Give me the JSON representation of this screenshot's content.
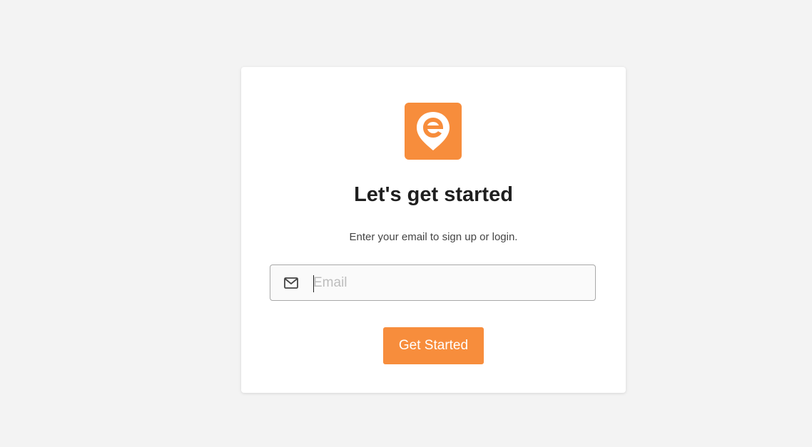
{
  "theme": {
    "page_background": "#f3f3f3",
    "card_background": "#ffffff",
    "accent": "#f78d3c"
  },
  "logo": {
    "icon": "location-pin-e-logo"
  },
  "heading": {
    "title": "Let's get started",
    "subtitle": "Enter your email to sign up or login."
  },
  "form": {
    "email_icon": "mail-icon",
    "email_placeholder": "Email",
    "email_value": "",
    "submit_label": "Get Started"
  }
}
